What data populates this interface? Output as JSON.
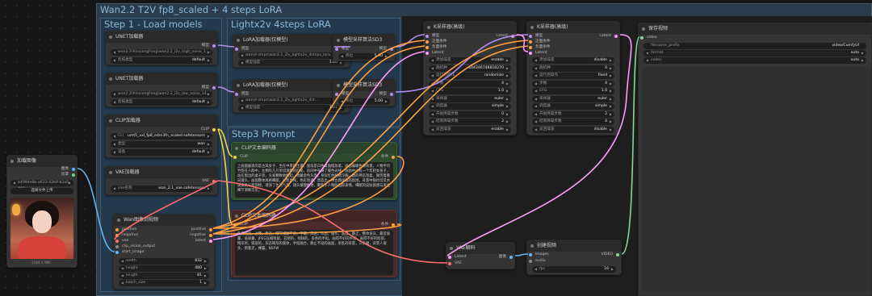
{
  "workflow_title": "Wan2.2 T2V fp8_scaled + 4 steps LoRA",
  "groups": {
    "load_models": "Step 1 - Load models",
    "lightx2v": "Lightx2v 4steps LoRA",
    "prompt": "Step3 Prompt"
  },
  "unet1": {
    "title": "UNET加载器",
    "model_out": "模型",
    "model_name": "wan2.2\\XinxiangFeng\\wan2.2_i2v_high_noise_1 ...",
    "dtype_label": "剪枝类型",
    "dtype_value": "default"
  },
  "unet2": {
    "title": "UNET加载器",
    "model_out": "模型",
    "model_name": "wan2.2\\XinxiangFeng\\wan2.2_i2v_low_noise_14...",
    "dtype_label": "剪枝类型",
    "dtype_value": "default"
  },
  "clip_loader": {
    "title": "CLIP加载器",
    "clip_out": "CLIP",
    "clip_label": "CLI",
    "clip_value": "umt5_xxl_fp8_e4m3fn_scaled.safetensors",
    "type_label": "类型",
    "type_value": "wan",
    "device_label": "设备",
    "device_value": "default"
  },
  "vae_loader": {
    "title": "VAE加载器",
    "vae_out": "VAE",
    "name_label": "vae名称",
    "name_value": "wan_2.1_vae.safetensors"
  },
  "lora1": {
    "title": "LoRA加载器(仅模型)",
    "model_in": "模型",
    "model_out": "模型",
    "lora_label": "",
    "lora_value": "wan\\4-steps\\wan2.2_i2v_lightx2v_4steps_lora_v1...",
    "strength_label": "模型强度",
    "strength_value": "1.00"
  },
  "lora2": {
    "title": "LoRA加载器(仅模型)",
    "model_in": "模型",
    "model_out": "模型",
    "lora_value": "wan\\4-steps\\wan2.2_i2v_lightx2v_4st...",
    "strength_label": "模型强度",
    "strength_value": "1.01"
  },
  "sd3_1": {
    "title": "模型采样算法SD3",
    "model_in": "模型",
    "model_out": "模型",
    "shift_label": "移位",
    "shift_value": "5.00"
  },
  "sd3_2": {
    "title": "模型采样算法SD3",
    "model_in": "模型",
    "model_out": "模型",
    "shift_label": "移位",
    "shift_value": "5.00"
  },
  "load_image": {
    "title": "加载图像",
    "image_out": "图像",
    "mask_out": "遮罩",
    "file_value": "b4994e8b-a633-42b9-b2a5-468",
    "upload_label": "选择文件上传",
    "size_label": "1184 × 960"
  },
  "wan_i2v": {
    "title": "Wan图像到视频",
    "inputs": [
      "positive",
      "negative",
      "vae",
      "clip_vision_output",
      "start_image"
    ],
    "outputs": [
      "positive",
      "negative",
      "latent"
    ],
    "widgets": [
      {
        "label": "width",
        "value": "832"
      },
      {
        "label": "height",
        "value": "480"
      },
      {
        "label": "length",
        "value": "81"
      },
      {
        "label": "batch_size",
        "value": "1"
      }
    ]
  },
  "clip_pos": {
    "title": "CLIP文本编码器",
    "clip_in": "CLIP",
    "cond_out": "条件",
    "text": "上画面展现的是古风女子、坐在中景的位置。面前是白色桌面摆放着。画面偏暖色调背景。人物手持竹签在人群中，左侧有几只亲切温暖的灯笼，房间中布满了暖色光线，画面中心有一个年轻女孩子，站在窗边的桌子旁，头发精致地挽起，佩戴金色头饰，身穿红色刺绣汉服，她的神态温柔，微笑着看向镜头，画面整体风格细腻，光影柔和，色彩饱满，营造出一种古典优雅的氛围，背景中隐约可见木质家具与装饰物，增添了生活气息，镜头缓慢推进，聚焦于人物的面部表情，细腻的皮肤质感与发丝细节清晰可见。"
  },
  "clip_neg": {
    "title": "CLIP文本编码器",
    "clip_in": "CLIP",
    "cond_out": "条件",
    "text": "色调艳丽，过曝，静态，细节模糊不清，字幕，风格，作品，画作，画面，静止，整体发灰，最差质量，低质量，JPEG压缩残留，丑陋的，残缺的，多余的手指，画得不好的手部，画得不好的脸部，畸形的，毁容的，形态畸形的肢体，手指融合，静止不动的画面，杂乱的背景，三条腿，背景人很多，倒着走，裸露，NSFW"
  },
  "ksampler1": {
    "title": "K采样器(高级)",
    "inputs": [
      "模型",
      "正面条件",
      "负面条件",
      "Latent"
    ],
    "output": "Latent",
    "widgets": [
      {
        "label": "添加噪波",
        "value": "enable"
      },
      {
        "label": "随机种",
        "value": "444346748818270"
      },
      {
        "label": "运行后操作",
        "value": "randomize"
      },
      {
        "label": "步数",
        "value": "4"
      },
      {
        "label": "CFG",
        "value": "1.0"
      },
      {
        "label": "采样器",
        "value": "euler"
      },
      {
        "label": "调度器",
        "value": "simple"
      },
      {
        "label": "开始降噪步数",
        "value": "0"
      },
      {
        "label": "结束降噪步数",
        "value": "2"
      },
      {
        "label": "返回噪波",
        "value": "enable"
      }
    ]
  },
  "ksampler2": {
    "title": "K采样器(高级)",
    "inputs": [
      "模型",
      "正面条件",
      "负面条件",
      "Latent"
    ],
    "output": "Latent",
    "widgets": [
      {
        "label": "添加噪波",
        "value": "disable"
      },
      {
        "label": "随机种",
        "value": "0"
      },
      {
        "label": "运行后操作",
        "value": "fixed"
      },
      {
        "label": "步数",
        "value": "4"
      },
      {
        "label": "CFG",
        "value": "1.0"
      },
      {
        "label": "采样器",
        "value": "euler"
      },
      {
        "label": "调度器",
        "value": "simple"
      },
      {
        "label": "开始降噪步数",
        "value": "2"
      },
      {
        "label": "结束降噪步数",
        "value": "4"
      },
      {
        "label": "返回噪波",
        "value": "disable"
      }
    ]
  },
  "vae_decode": {
    "title": "VAE解码",
    "inputs": [
      "Latent",
      "VAE"
    ],
    "output": "图像"
  },
  "create_video": {
    "title": "创建视频",
    "inputs": [
      "images",
      "audio"
    ],
    "output": "VIDEO",
    "fps_label": "fps",
    "fps_value": "16"
  },
  "save_video": {
    "title": "保存视频",
    "input": "video",
    "widgets": [
      {
        "label": "filename_prefix",
        "value": "video/ComfyUI"
      },
      {
        "label": "format",
        "value": "auto"
      },
      {
        "label": "codec",
        "value": "auto"
      }
    ]
  },
  "colors": {
    "model": "#b48cf0",
    "clip": "#f2d14b",
    "vae": "#ff6e6e",
    "cond": "#ffa040",
    "latent": "#ff9cf9",
    "image": "#64b5f6",
    "video": "#8bd39c"
  }
}
